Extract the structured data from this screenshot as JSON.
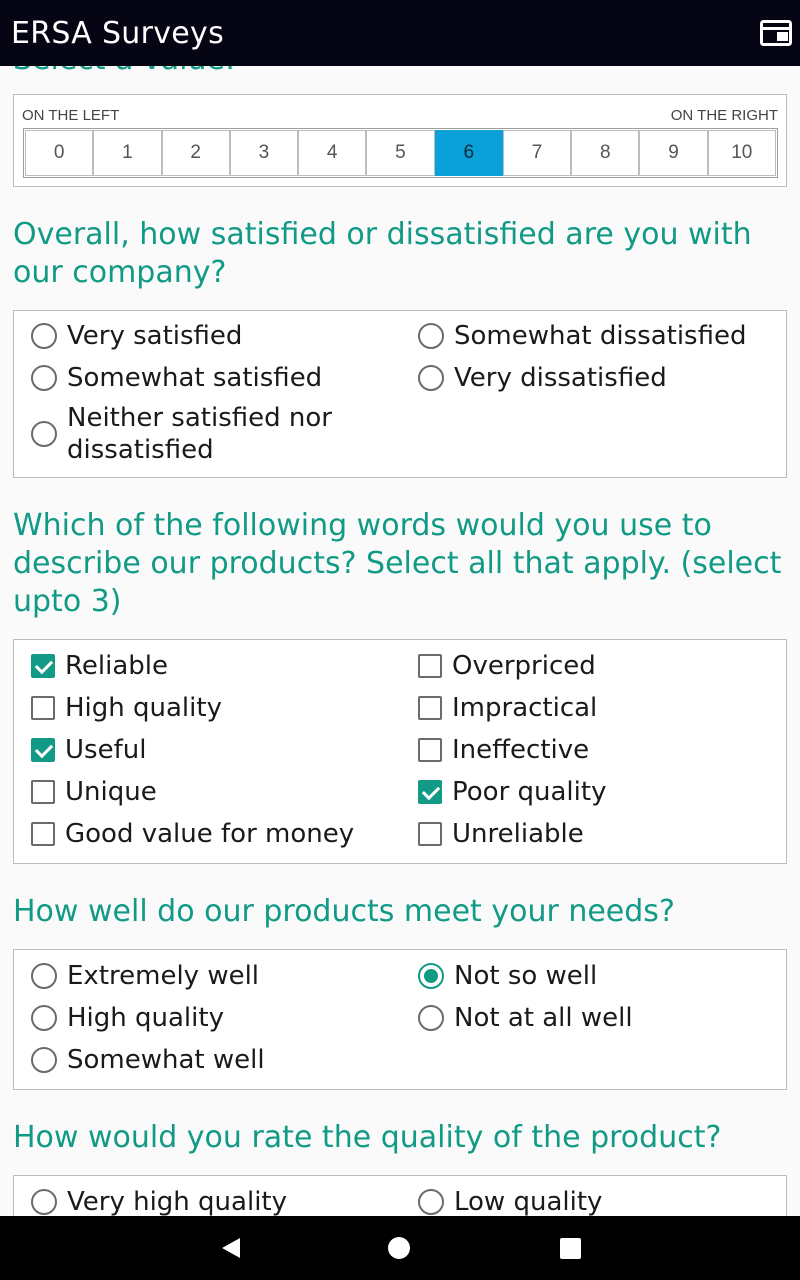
{
  "app": {
    "title": "ERSA Surveys"
  },
  "cut_heading": "Select a value:",
  "scale": {
    "left_label": "ON THE LEFT",
    "right_label": "ON THE RIGHT",
    "values": [
      "0",
      "1",
      "2",
      "3",
      "4",
      "5",
      "6",
      "7",
      "8",
      "9",
      "10"
    ],
    "selected": "6"
  },
  "q1": {
    "question": "Overall, how satisfied or dissatisfied are you with our company?",
    "options": [
      {
        "label": "Very satisfied",
        "selected": false
      },
      {
        "label": "Somewhat satisfied",
        "selected": false
      },
      {
        "label": "Neither satisfied nor dissatisfied",
        "selected": false
      },
      {
        "label": "Somewhat dissatisfied",
        "selected": false
      },
      {
        "label": "Very dissatisfied",
        "selected": false
      }
    ]
  },
  "q2": {
    "question": "Which of the following words would you use to describe our products? Select all that apply. (select upto 3)",
    "options": [
      {
        "label": "Reliable",
        "checked": true
      },
      {
        "label": "High quality",
        "checked": false
      },
      {
        "label": "Useful",
        "checked": true
      },
      {
        "label": "Unique",
        "checked": false
      },
      {
        "label": "Good value for money",
        "checked": false
      },
      {
        "label": "Overpriced",
        "checked": false
      },
      {
        "label": "Impractical",
        "checked": false
      },
      {
        "label": "Ineffective",
        "checked": false
      },
      {
        "label": "Poor quality",
        "checked": true
      },
      {
        "label": "Unreliable",
        "checked": false
      }
    ]
  },
  "q3": {
    "question": "How well do our products meet your needs?",
    "options": [
      {
        "label": "Extremely well",
        "selected": false
      },
      {
        "label": "High quality",
        "selected": false
      },
      {
        "label": "Somewhat well",
        "selected": false
      },
      {
        "label": "Not so well",
        "selected": true
      },
      {
        "label": "Not at all well",
        "selected": false
      }
    ]
  },
  "q4": {
    "question": "How would you rate the quality of the product?",
    "options": [
      {
        "label": "Very high quality",
        "selected": false
      },
      {
        "label": "Low quality",
        "selected": false
      }
    ]
  },
  "colors": {
    "accent": "#119a85",
    "scale_selected": "#0aa0d8",
    "appbar": "#050514"
  },
  "icons": {
    "window": "window-icon",
    "back": "back-icon",
    "home": "home-icon",
    "recents": "recents-icon"
  }
}
